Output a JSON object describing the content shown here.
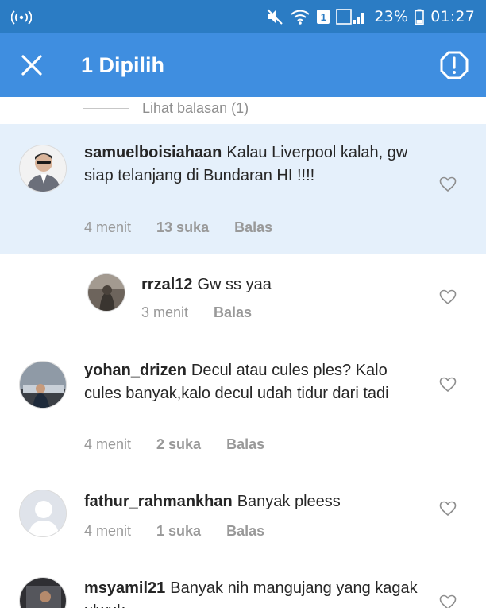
{
  "status_bar": {
    "battery": "23%",
    "time": "01:27",
    "sim_badge": "1",
    "color": "#2b7cc4"
  },
  "action_bar": {
    "title": "1 Dipilih",
    "color": "#3f8ee0"
  },
  "view_replies": "Lihat balasan (1)",
  "selected_color": "#e5f0fb",
  "comments": [
    {
      "username": "samuelboisiahaan",
      "text": "Kalau Liverpool kalah, gw siap telanjang di Bundaran HI !!!!",
      "time": "4 menit",
      "likes": "13 suka",
      "reply": "Balas"
    },
    {
      "username": "rrzal12",
      "text": "Gw ss yaa",
      "time": "3 menit",
      "reply": "Balas"
    },
    {
      "username": "yohan_drizen",
      "text": "Decul atau cules ples? Kalo cules banyak,kalo decul udah tidur dari tadi",
      "time": "4 menit",
      "likes": "2 suka",
      "reply": "Balas"
    },
    {
      "username": "fathur_rahmankhan",
      "text": "Banyak pleess",
      "time": "4 menit",
      "likes": "1 suka",
      "reply": "Balas"
    },
    {
      "username": "msyamil21",
      "text": "Banyak nih mangujang yang kagak ulwuk"
    }
  ]
}
